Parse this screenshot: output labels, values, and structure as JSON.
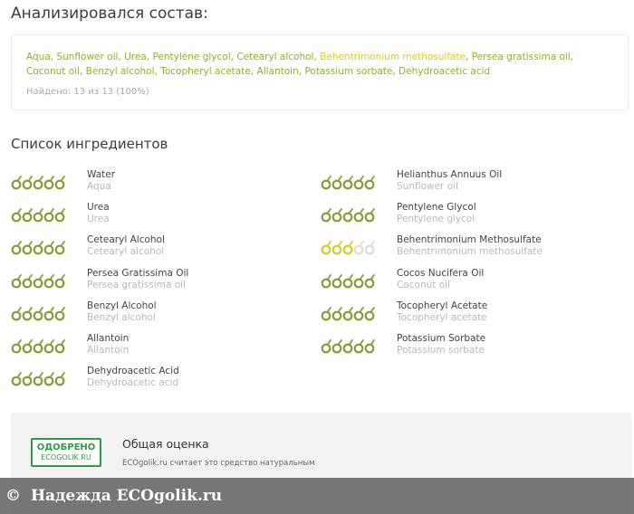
{
  "analysis": {
    "title": "Анализировался состав:",
    "ingredients": [
      {
        "name": "Aqua",
        "color": "green"
      },
      {
        "name": "Sunflower oil",
        "color": "green"
      },
      {
        "name": "Urea",
        "color": "green"
      },
      {
        "name": "Pentylene glycol",
        "color": "green"
      },
      {
        "name": "Cetearyl alcohol",
        "color": "green"
      },
      {
        "name": "Behentrimonium methosulfate",
        "color": "yellow"
      },
      {
        "name": "Persea gratissima oil",
        "color": "green"
      },
      {
        "name": "Coconut oil",
        "color": "green"
      },
      {
        "name": "Benzyl alcohol",
        "color": "green"
      },
      {
        "name": "Tocopheryl acetate",
        "color": "green"
      },
      {
        "name": "Allantoin",
        "color": "green"
      },
      {
        "name": "Potassium sorbate",
        "color": "green"
      },
      {
        "name": "Dehydroacetic acid",
        "color": "green"
      }
    ],
    "found": "Найдено: 13 из 13 (100%)"
  },
  "list": {
    "title": "Список ингредиентов",
    "items": [
      {
        "name": "Water",
        "sub": "Aqua",
        "score": 5
      },
      {
        "name": "Helianthus Annuus Oil",
        "sub": "Sunflower oil",
        "score": 5
      },
      {
        "name": "Urea",
        "sub": "Urea",
        "score": 5
      },
      {
        "name": "Pentylene Glycol",
        "sub": "Pentylene glycol",
        "score": 5
      },
      {
        "name": "Cetearyl Alcohol",
        "sub": "Cetearyl alcohol",
        "score": 5
      },
      {
        "name": "Behentrimonium Methosulfate",
        "sub": "Behentrimonium methosulfate",
        "score": 3
      },
      {
        "name": "Persea Gratissima Oil",
        "sub": "Persea gratissima oil",
        "score": 5
      },
      {
        "name": "Cocos Nucifera Oil",
        "sub": "Coconut oil",
        "score": 5
      },
      {
        "name": "Benzyl Alcohol",
        "sub": "Benzyl alcohol",
        "score": 5
      },
      {
        "name": "Tocopheryl Acetate",
        "sub": "Tocopheryl acetate",
        "score": 5
      },
      {
        "name": "Allantoin",
        "sub": "Allantoin",
        "score": 5
      },
      {
        "name": "Potassium Sorbate",
        "sub": "Potassium sorbate",
        "score": 5
      },
      {
        "name": "Dehydroacetic Acid",
        "sub": "Dehydroacetic acid",
        "score": 5
      }
    ]
  },
  "rating": {
    "stamp_line1": "ОДОБРЕНО",
    "stamp_line2": "ECOGOLIK.RU",
    "title": "Общая оценка",
    "text": "ECOgolik.ru считает это средство натуральным"
  },
  "footer": {
    "copyright": "©",
    "caption": "Надежда  ECOgolik.ru"
  },
  "colors": {
    "green": "#8bb02f",
    "olive": "#8a9a3b",
    "yellow": "#d6cc2f",
    "grey_dot": "#dcdcdc",
    "stamp": "#2e9a44"
  }
}
